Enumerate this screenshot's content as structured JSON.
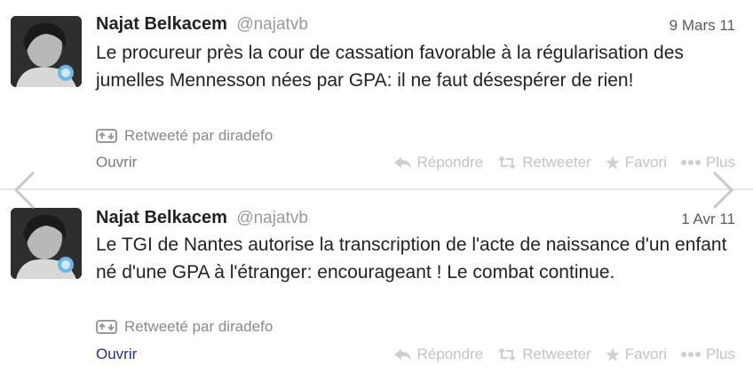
{
  "tweets": [
    {
      "name": "Najat Belkacem",
      "handle": "@najatvb",
      "date": "9 Mars 11",
      "text": "Le procureur près la cour de cassation favorable à la régularisation des jumelles Mennesson nées par GPA: il ne faut désespérer de rien!",
      "retweeted_by": "Retweeté par diradefo",
      "open_label": "Ouvrir",
      "actions": {
        "reply": "Répondre",
        "retweet": "Retweeter",
        "favorite": "Favori",
        "more": "Plus"
      }
    },
    {
      "name": "Najat Belkacem",
      "handle": "@najatvb",
      "date": "1 Avr 11",
      "text": "Le TGI de Nantes autorise la transcription de l'acte de naissance d'un enfant né d'une GPA à l'étranger: encourageant ! Le combat continue.",
      "retweeted_by": "Retweeté par diradefo",
      "open_label": "Ouvrir",
      "actions": {
        "reply": "Répondre",
        "retweet": "Retweeter",
        "favorite": "Favori",
        "more": "Plus"
      }
    }
  ],
  "icons": [
    "avatar",
    "retweet-icon",
    "reply-icon",
    "star-icon",
    "more-icon",
    "chevron-left-icon",
    "chevron-right-icon"
  ],
  "colors": {
    "text": "#222222",
    "muted": "#8a8a8a",
    "action": "#c4c4c4",
    "divider": "#e6e6e6",
    "link_visited": "#2c2c8a"
  }
}
